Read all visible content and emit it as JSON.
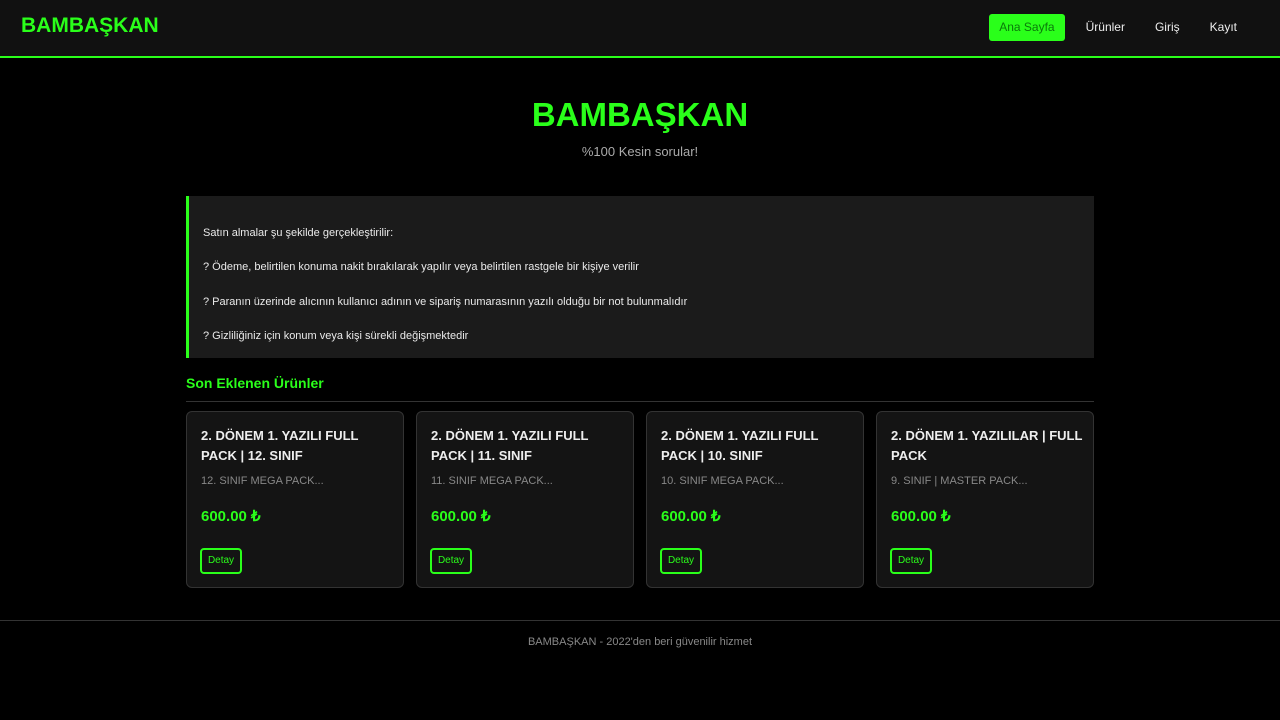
{
  "header": {
    "brand": "BAMBAŞKAN",
    "nav": [
      {
        "label": "Ana Sayfa",
        "active": true
      },
      {
        "label": "Ürünler",
        "active": false
      },
      {
        "label": "Giriş",
        "active": false
      },
      {
        "label": "Kayıt",
        "active": false
      }
    ]
  },
  "hero": {
    "title": "BAMBAŞKAN",
    "subtitle": "%100 Kesin sorular!"
  },
  "info": {
    "lines": [
      "Satın almalar şu şekilde gerçekleştirilir:",
      "? Ödeme, belirtilen konuma nakit bırakılarak yapılır veya belirtilen rastgele bir kişiye verilir",
      "? Paranın üzerinde alıcının kullanıcı adının ve sipariş numarasının yazılı olduğu bir not bulunmalıdır",
      "? Gizliliğiniz için konum veya kişi sürekli değişmektedir"
    ]
  },
  "products_section": {
    "title": "Son Eklenen Ürünler",
    "items": [
      {
        "title": "2. DÖNEM 1. YAZILI FULL PACK | 12. SINIF",
        "desc": "12. SINIF MEGA PACK...",
        "price": "600.00 ₺",
        "button": "Detay"
      },
      {
        "title": "2. DÖNEM 1. YAZILI FULL PACK | 11. SINIF",
        "desc": "11. SINIF MEGA PACK...",
        "price": "600.00 ₺",
        "button": "Detay"
      },
      {
        "title": "2. DÖNEM 1. YAZILI FULL PACK | 10. SINIF",
        "desc": "10. SINIF MEGA PACK...",
        "price": "600.00 ₺",
        "button": "Detay"
      },
      {
        "title": "2. DÖNEM 1. YAZILILAR | FULL PACK",
        "desc": "9. SINIF | MASTER PACK...",
        "price": "600.00 ₺",
        "button": "Detay"
      }
    ]
  },
  "footer": {
    "text": "BAMBAŞKAN - 2022'den beri güvenilir hizmet"
  },
  "colors": {
    "accent": "#2aff1a",
    "background": "#000000",
    "panel": "#1b1b1b"
  }
}
